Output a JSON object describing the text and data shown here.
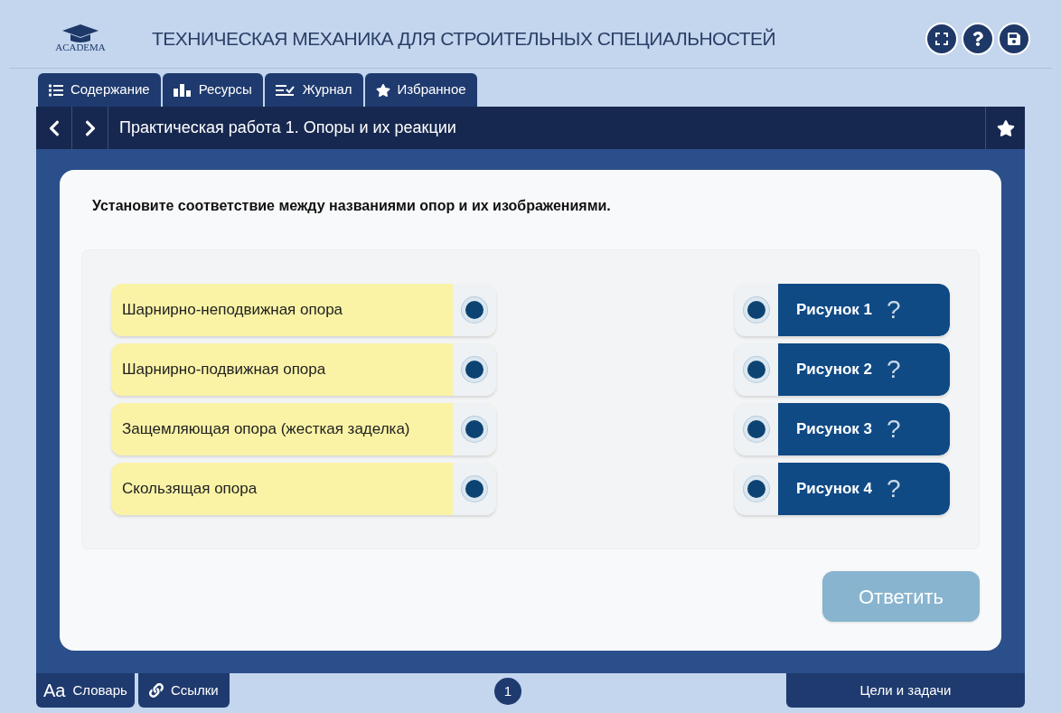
{
  "header": {
    "logo_text": "ACADEMA",
    "title": "ТЕХНИЧЕСКАЯ МЕХАНИКА ДЛЯ СТРОИТЕЛЬНЫХ СПЕЦИАЛЬНОСТЕЙ"
  },
  "tabs": [
    {
      "kind": "list",
      "label": "Содержание",
      "selected": false
    },
    {
      "kind": "chart",
      "label": "Ресурсы",
      "selected": false
    },
    {
      "kind": "journal",
      "label": "Журнал",
      "selected": false
    },
    {
      "kind": "star",
      "label": "Избранное",
      "selected": false
    }
  ],
  "lesson_bar": {
    "title": "Практическая работа 1. Опоры и их реакции"
  },
  "task": {
    "instruction": "Установите соответствие между названиями опор и их изображениями.",
    "left_items": [
      {
        "label": "Шарнирно-неподвижная опора"
      },
      {
        "label": "Шарнирно-подвижная опора"
      },
      {
        "label": "Защемляющая опора (жесткая заделка)"
      },
      {
        "label": "Скользящая опора"
      }
    ],
    "right_items": [
      {
        "label": "Рисунок 1",
        "hint": "?"
      },
      {
        "label": "Рисунок 2",
        "hint": "?"
      },
      {
        "label": "Рисунок 3",
        "hint": "?"
      },
      {
        "label": "Рисунок 4",
        "hint": "?"
      }
    ],
    "answer_button": {
      "label": "Ответить",
      "disabled": true
    }
  },
  "footer": {
    "glossary": {
      "icon_text": "Aa",
      "label": "Словарь"
    },
    "links": {
      "label": "Ссылки"
    },
    "page": "1",
    "goals": "Цели и задачи"
  }
}
